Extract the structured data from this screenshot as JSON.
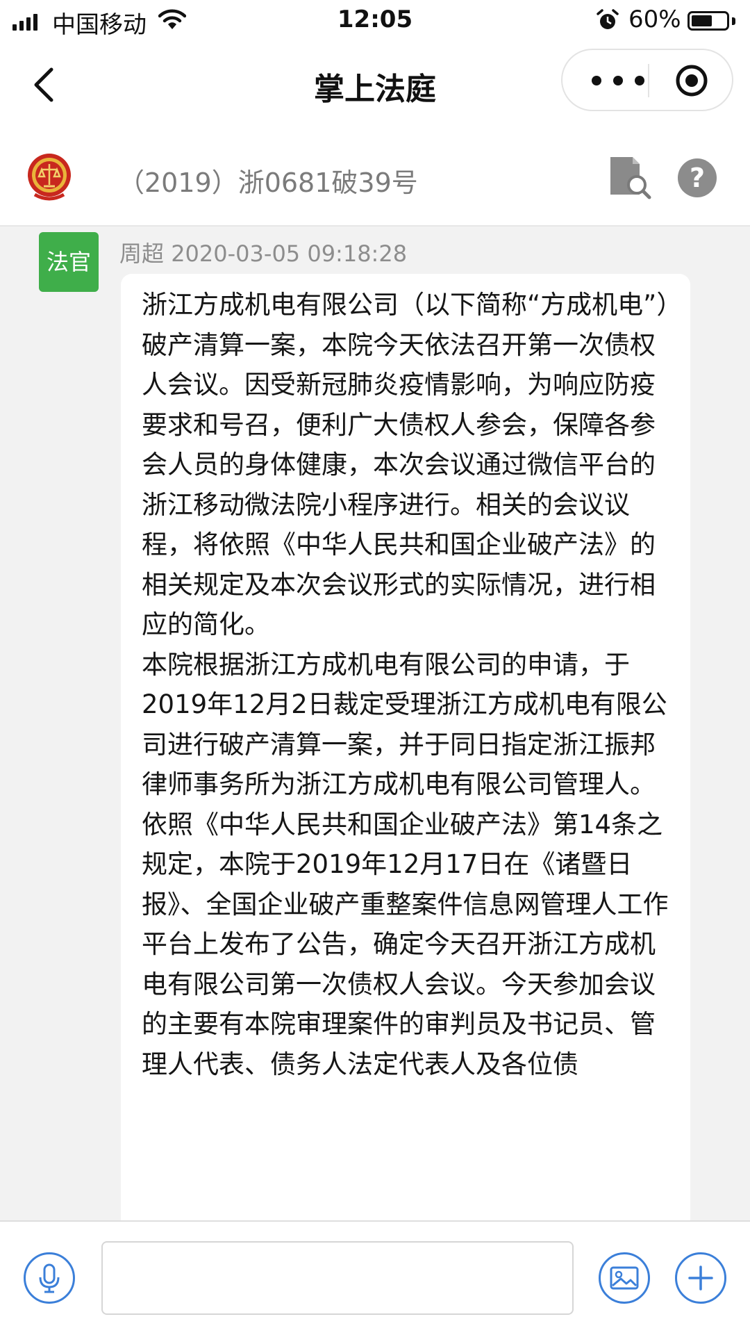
{
  "status_bar": {
    "carrier": "中国移动",
    "time": "12:05",
    "battery_percent": "60%",
    "battery_level": 0.6
  },
  "nav": {
    "title": "掌上法庭"
  },
  "case": {
    "number": "（2019）浙0681破39号"
  },
  "message": {
    "avatar_label": "法官",
    "sender": "周超",
    "timestamp": "2020-03-05 09:18:28",
    "paragraphs": [
      "浙江方成机电有限公司（以下简称“方成机电”）破产清算一案，本院今天依法召开第一次债权人会议。因受新冠肺炎疫情影响，为响应防疫要求和号召，便利广大债权人参会，保障各参会人员的身体健康，本次会议通过微信平台的浙江移动微法院小程序进行。相关的会议议程，将依照《中华人民共和国企业破产法》的相关规定及本次会议形式的实际情况，进行相应的简化。",
      "本院根据浙江方成机电有限公司的申请，于2019年12月2日裁定受理浙江方成机电有限公司进行破产清算一案，并于同日指定浙江振邦律师事务所为浙江方成机电有限公司管理人。",
      "依照《中华人民共和国企业破产法》第14条之规定，本院于2019年12月17日在《诸暨日报》、全国企业破产重整案件信息网管理人工作平台上发布了公告，确定今天召开浙江方成机电有限公司第一次债权人会议。今天参加会议的主要有本院审理案件的审判员及书记员、管理人代表、债务人法定代表人及各位债"
    ]
  },
  "input": {
    "value": ""
  },
  "icons": {
    "back": "chevron-left-icon",
    "more": "more-dots-icon",
    "close": "target-close-icon",
    "emblem": "court-emblem-icon",
    "search_doc": "document-search-icon",
    "help": "help-icon",
    "voice": "microphone-icon",
    "image": "image-icon",
    "plus": "plus-icon"
  },
  "colors": {
    "avatar_green": "#3fae4a",
    "accent_blue": "#3b7fd9",
    "chat_background": "#f2f2f2"
  }
}
